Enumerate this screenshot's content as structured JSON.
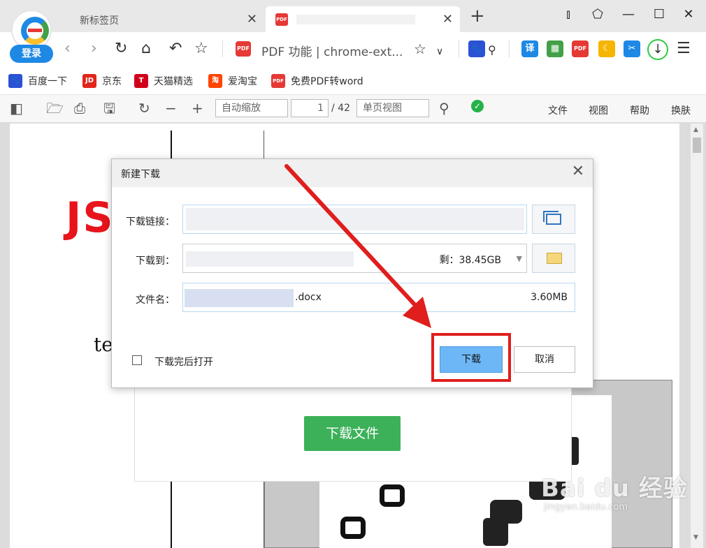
{
  "browser": {
    "login_label": "登录",
    "tabs": [
      {
        "title": "新标签页"
      },
      {
        "title": ""
      }
    ],
    "address_text": "PDF 功能 | chrome-ext...",
    "bookmarks": [
      {
        "label": "百度一下",
        "icon": "baidu-paw-icon",
        "color": "#2b52d4",
        "glyph": "🐾"
      },
      {
        "label": "京东",
        "icon": "jd-icon",
        "color": "#e1251b",
        "glyph": "JD"
      },
      {
        "label": "天猫精选",
        "icon": "tmall-icon",
        "color": "#d0021b",
        "glyph": "T"
      },
      {
        "label": "爱淘宝",
        "icon": "taobao-icon",
        "color": "#ff4400",
        "glyph": "淘"
      },
      {
        "label": "免费PDF转word",
        "icon": "pdf-icon",
        "color": "#e53935",
        "glyph": "PDF"
      }
    ],
    "extensions": [
      {
        "name": "translate-ext-icon",
        "glyph": "译",
        "color": "#1e88e5"
      },
      {
        "name": "apps-ext-icon",
        "glyph": "▦",
        "color": "#43a047"
      },
      {
        "name": "pdf-ext-icon",
        "glyph": "PDF",
        "color": "#e53935"
      },
      {
        "name": "moon-ext-icon",
        "glyph": "☾",
        "color": "#f6b500"
      },
      {
        "name": "scissors-ext-icon",
        "glyph": "✂",
        "color": "#1e88e5"
      }
    ]
  },
  "pdf_toolbar": {
    "zoom": "自动缩放",
    "page_current": "1",
    "page_total": "/ 42",
    "view_mode": "单页视图",
    "menu": [
      "文件",
      "视图",
      "帮助",
      "换肤"
    ]
  },
  "document": {
    "heading_fragment": "JS",
    "text_fragment": "tes",
    "download_file_button": "下载文件"
  },
  "dialog": {
    "title": "新建下载",
    "link_label": "下载链接：",
    "save_label": "下载到：",
    "remaining_space": "剩：38.45GB",
    "filename_label": "文件名：",
    "filename_ext": ".docx",
    "file_size": "3.60MB",
    "open_after_label": "下载完后打开",
    "download_button": "下载",
    "cancel_button": "取消"
  },
  "watermark": {
    "main": "Bai du 经验",
    "sub": "jingyan.baidu.com"
  },
  "colors": {
    "highlight": "#e01e1e",
    "primary_button": "#6eb7f6",
    "green_button": "#3cb15a"
  }
}
